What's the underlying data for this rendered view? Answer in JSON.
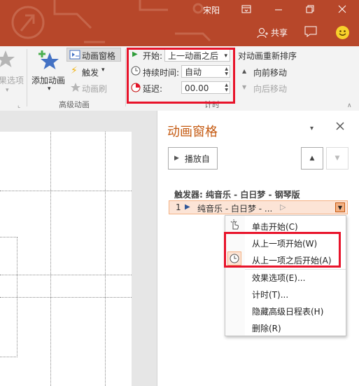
{
  "titlebar": {
    "user": "宋阳",
    "share_label": "共享",
    "colors": {
      "background": "#b7472a",
      "text": "#ffffff"
    }
  },
  "ribbon": {
    "left_partial": {
      "effect_options_label": "果选项"
    },
    "advanced": {
      "add_animation_label": "添加动画",
      "animation_pane_label": "动画窗格",
      "trigger_label": "触发",
      "animation_painter_label": "动画刷",
      "group_label": "高级动画"
    },
    "timing": {
      "start_label": "开始:",
      "start_value": "上一动画之后",
      "duration_label": "持续时间:",
      "duration_value": "自动",
      "delay_label": "延迟:",
      "delay_value": "00.00",
      "reorder_label": "对动画重新排序",
      "move_earlier_label": "向前移动",
      "move_later_label": "向后移动",
      "group_label": "计时"
    }
  },
  "pane": {
    "title": "动画窗格",
    "play_label": "播放自",
    "trigger_heading": "触发器: 纯音乐 - 白日梦 - 钢琴版",
    "item": {
      "number": "1",
      "label": "纯音乐 - 白日梦 - ..."
    }
  },
  "context_menu": {
    "items": [
      {
        "label": "单击开始(C)",
        "icon": "mouse-click-icon"
      },
      {
        "label": "从上一项开始(W)",
        "icon": ""
      },
      {
        "label": "从上一项之后开始(A)",
        "icon": "clock-icon",
        "checked": true
      },
      {
        "label": "效果选项(E)...",
        "icon": ""
      },
      {
        "label": "计时(T)...",
        "icon": ""
      },
      {
        "label": "隐藏高级日程表(H)",
        "icon": ""
      },
      {
        "label": "删除(R)",
        "icon": ""
      }
    ]
  },
  "colors": {
    "accent": "#c55a11",
    "highlight_box": "#e8132a",
    "selected_row": "#fce4d6"
  }
}
